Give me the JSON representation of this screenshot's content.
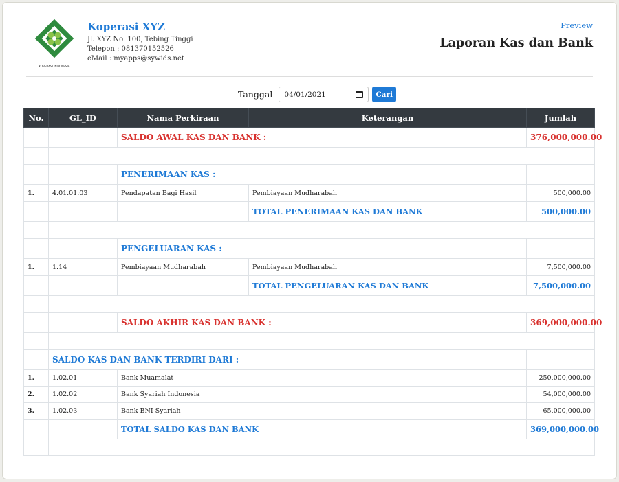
{
  "company": {
    "name": "Koperasi XYZ",
    "address": "Jl. XYZ No. 100, Tebing Tinggi",
    "phone": "Telepon : 081370152526",
    "email": "eMail : myapps@sywids.net",
    "logo_caption": "KOPERASI INDONESIA"
  },
  "header": {
    "preview_link": "Preview",
    "title": "Laporan Kas dan Bank"
  },
  "filter": {
    "label": "Tanggal",
    "date_value": "04/01/2021",
    "button_label": "Cari"
  },
  "table": {
    "columns": [
      "No.",
      "GL_ID",
      "Nama Perkiraan",
      "Keterangan",
      "Jumlah"
    ],
    "saldo_awal": {
      "label": "SALDO AWAL KAS DAN BANK :",
      "amount": "376,000,000.00"
    },
    "penerimaan": {
      "heading": "PENERIMAAN KAS :",
      "rows": [
        {
          "no": "1.",
          "gl_id": "4.01.01.03",
          "nama": "Pendapatan Bagi Hasil",
          "keterangan": "Pembiayaan Mudharabah",
          "jumlah": "500,000.00"
        }
      ],
      "total_label": "TOTAL PENERIMAAN KAS DAN BANK",
      "total_amount": "500,000.00"
    },
    "pengeluaran": {
      "heading": "PENGELUARAN KAS :",
      "rows": [
        {
          "no": "1.",
          "gl_id": "1.14",
          "nama": "Pembiayaan Mudharabah",
          "keterangan": "Pembiayaan Mudharabah",
          "jumlah": "7,500,000.00"
        }
      ],
      "total_label": "TOTAL PENGELUARAN KAS DAN BANK",
      "total_amount": "7,500,000.00"
    },
    "saldo_akhir": {
      "label": "SALDO AKHIR KAS DAN BANK :",
      "amount": "369,000,000.00"
    },
    "terdiri": {
      "heading": "SALDO KAS DAN BANK TERDIRI DARI :",
      "rows": [
        {
          "no": "1.",
          "gl_id": "1.02.01",
          "nama": "Bank Muamalat",
          "jumlah": "250,000,000.00"
        },
        {
          "no": "2.",
          "gl_id": "1.02.02",
          "nama": "Bank Syariah Indonesia",
          "jumlah": "54,000,000.00"
        },
        {
          "no": "3.",
          "gl_id": "1.02.03",
          "nama": "Bank BNI Syariah",
          "jumlah": "65,000,000.00"
        }
      ],
      "total_label": "TOTAL SALDO KAS DAN BANK",
      "total_amount": "369,000,000.00"
    }
  },
  "colors": {
    "accent_blue": "#1f7ad6",
    "accent_red": "#d8322f",
    "header_dark": "#343a40",
    "logo_green": "#2e8b3e"
  }
}
